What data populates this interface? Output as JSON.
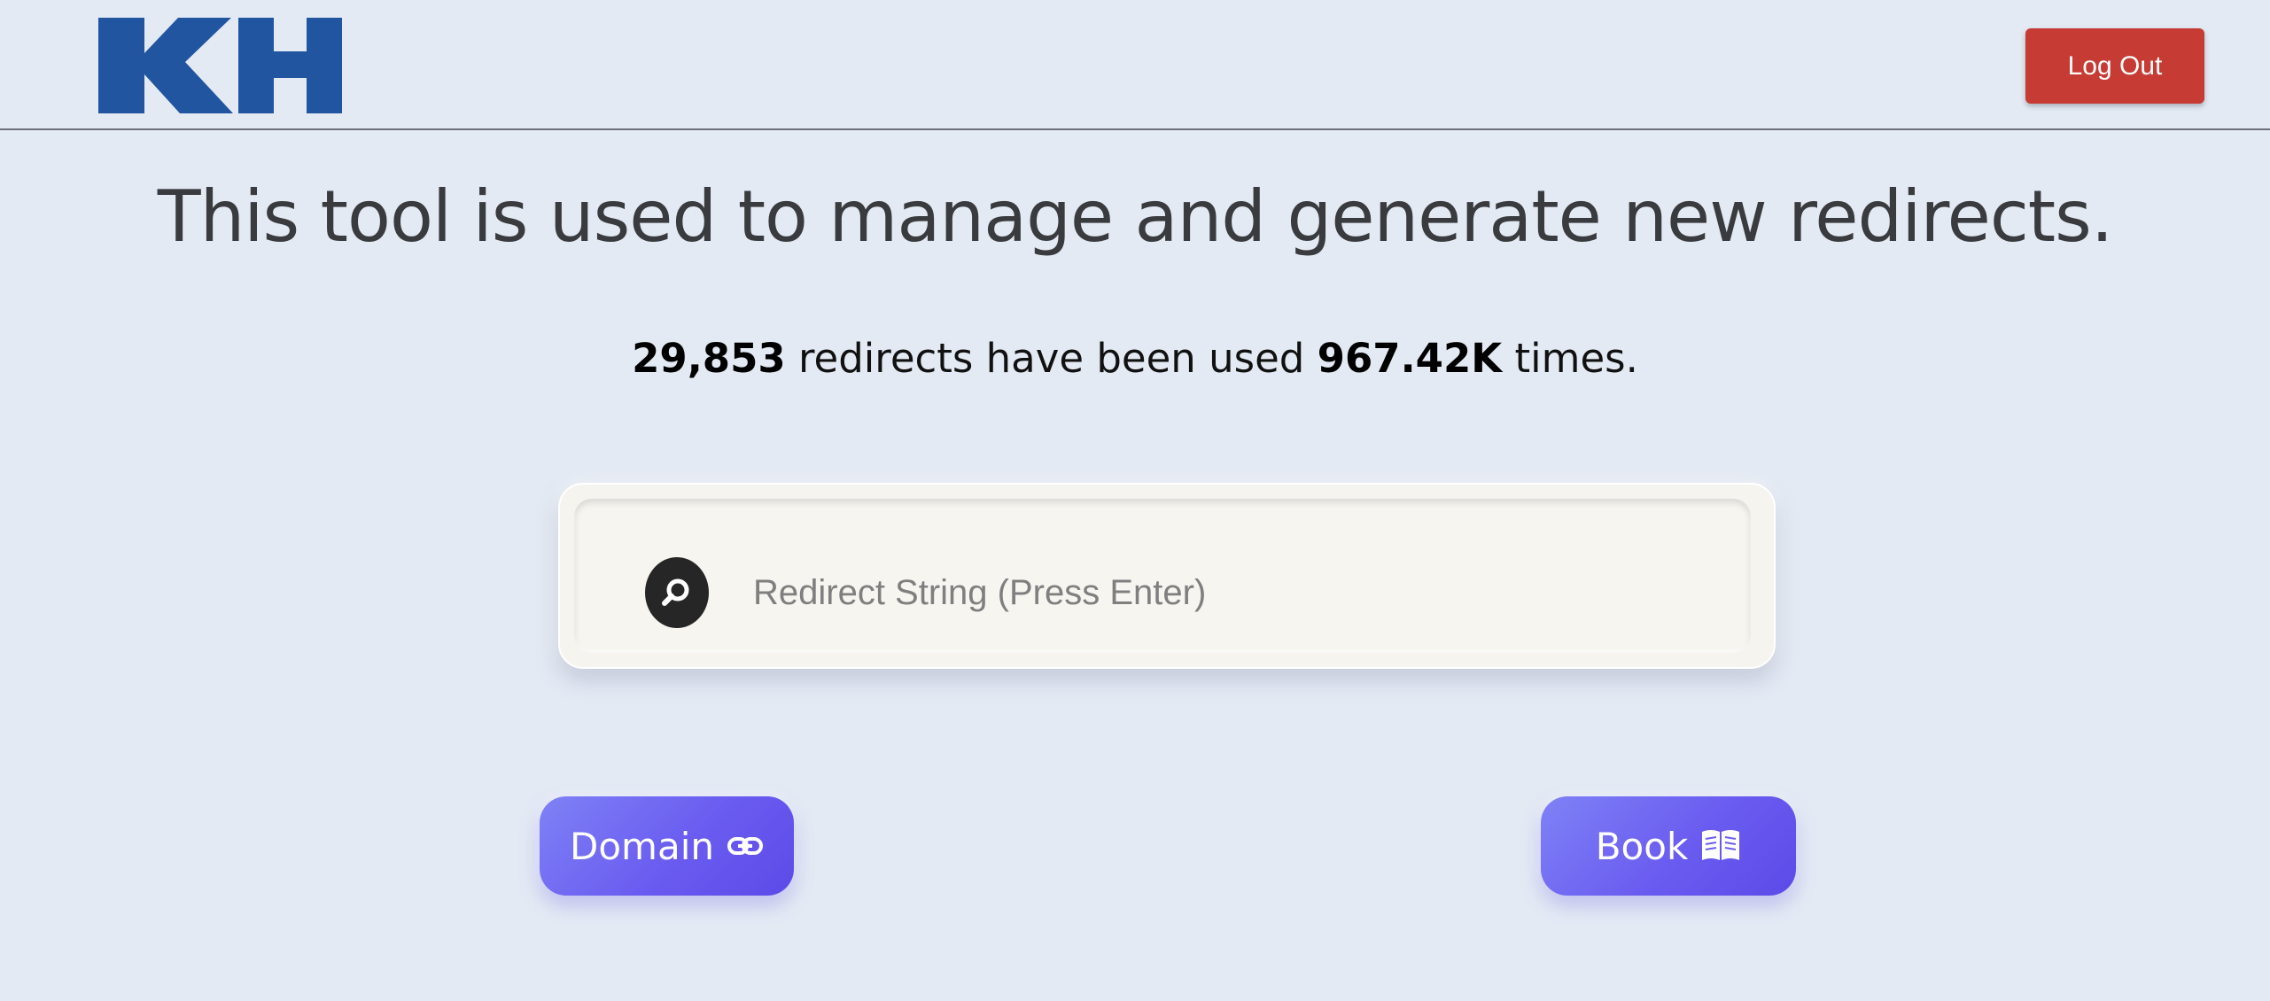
{
  "header": {
    "logo_text": "KH",
    "logout_label": "Log Out"
  },
  "main": {
    "headline": "This tool is used to manage and generate new redirects.",
    "stats": {
      "redirect_count": "29,853",
      "text_middle": " redirects have been used ",
      "usage_count": "967.42K",
      "text_end": " times."
    },
    "search": {
      "placeholder": "Redirect String (Press Enter)",
      "value": "",
      "icon": "search-icon"
    },
    "buttons": {
      "domain_label": "Domain",
      "domain_icon": "link-icon",
      "book_label": "Book",
      "book_icon": "book-icon"
    }
  },
  "colors": {
    "background": "#e4eaf4",
    "logo": "#2255a0",
    "logout": "#c63b33",
    "button_gradient_start": "#7f82f6",
    "button_gradient_end": "#5d4ae8"
  }
}
